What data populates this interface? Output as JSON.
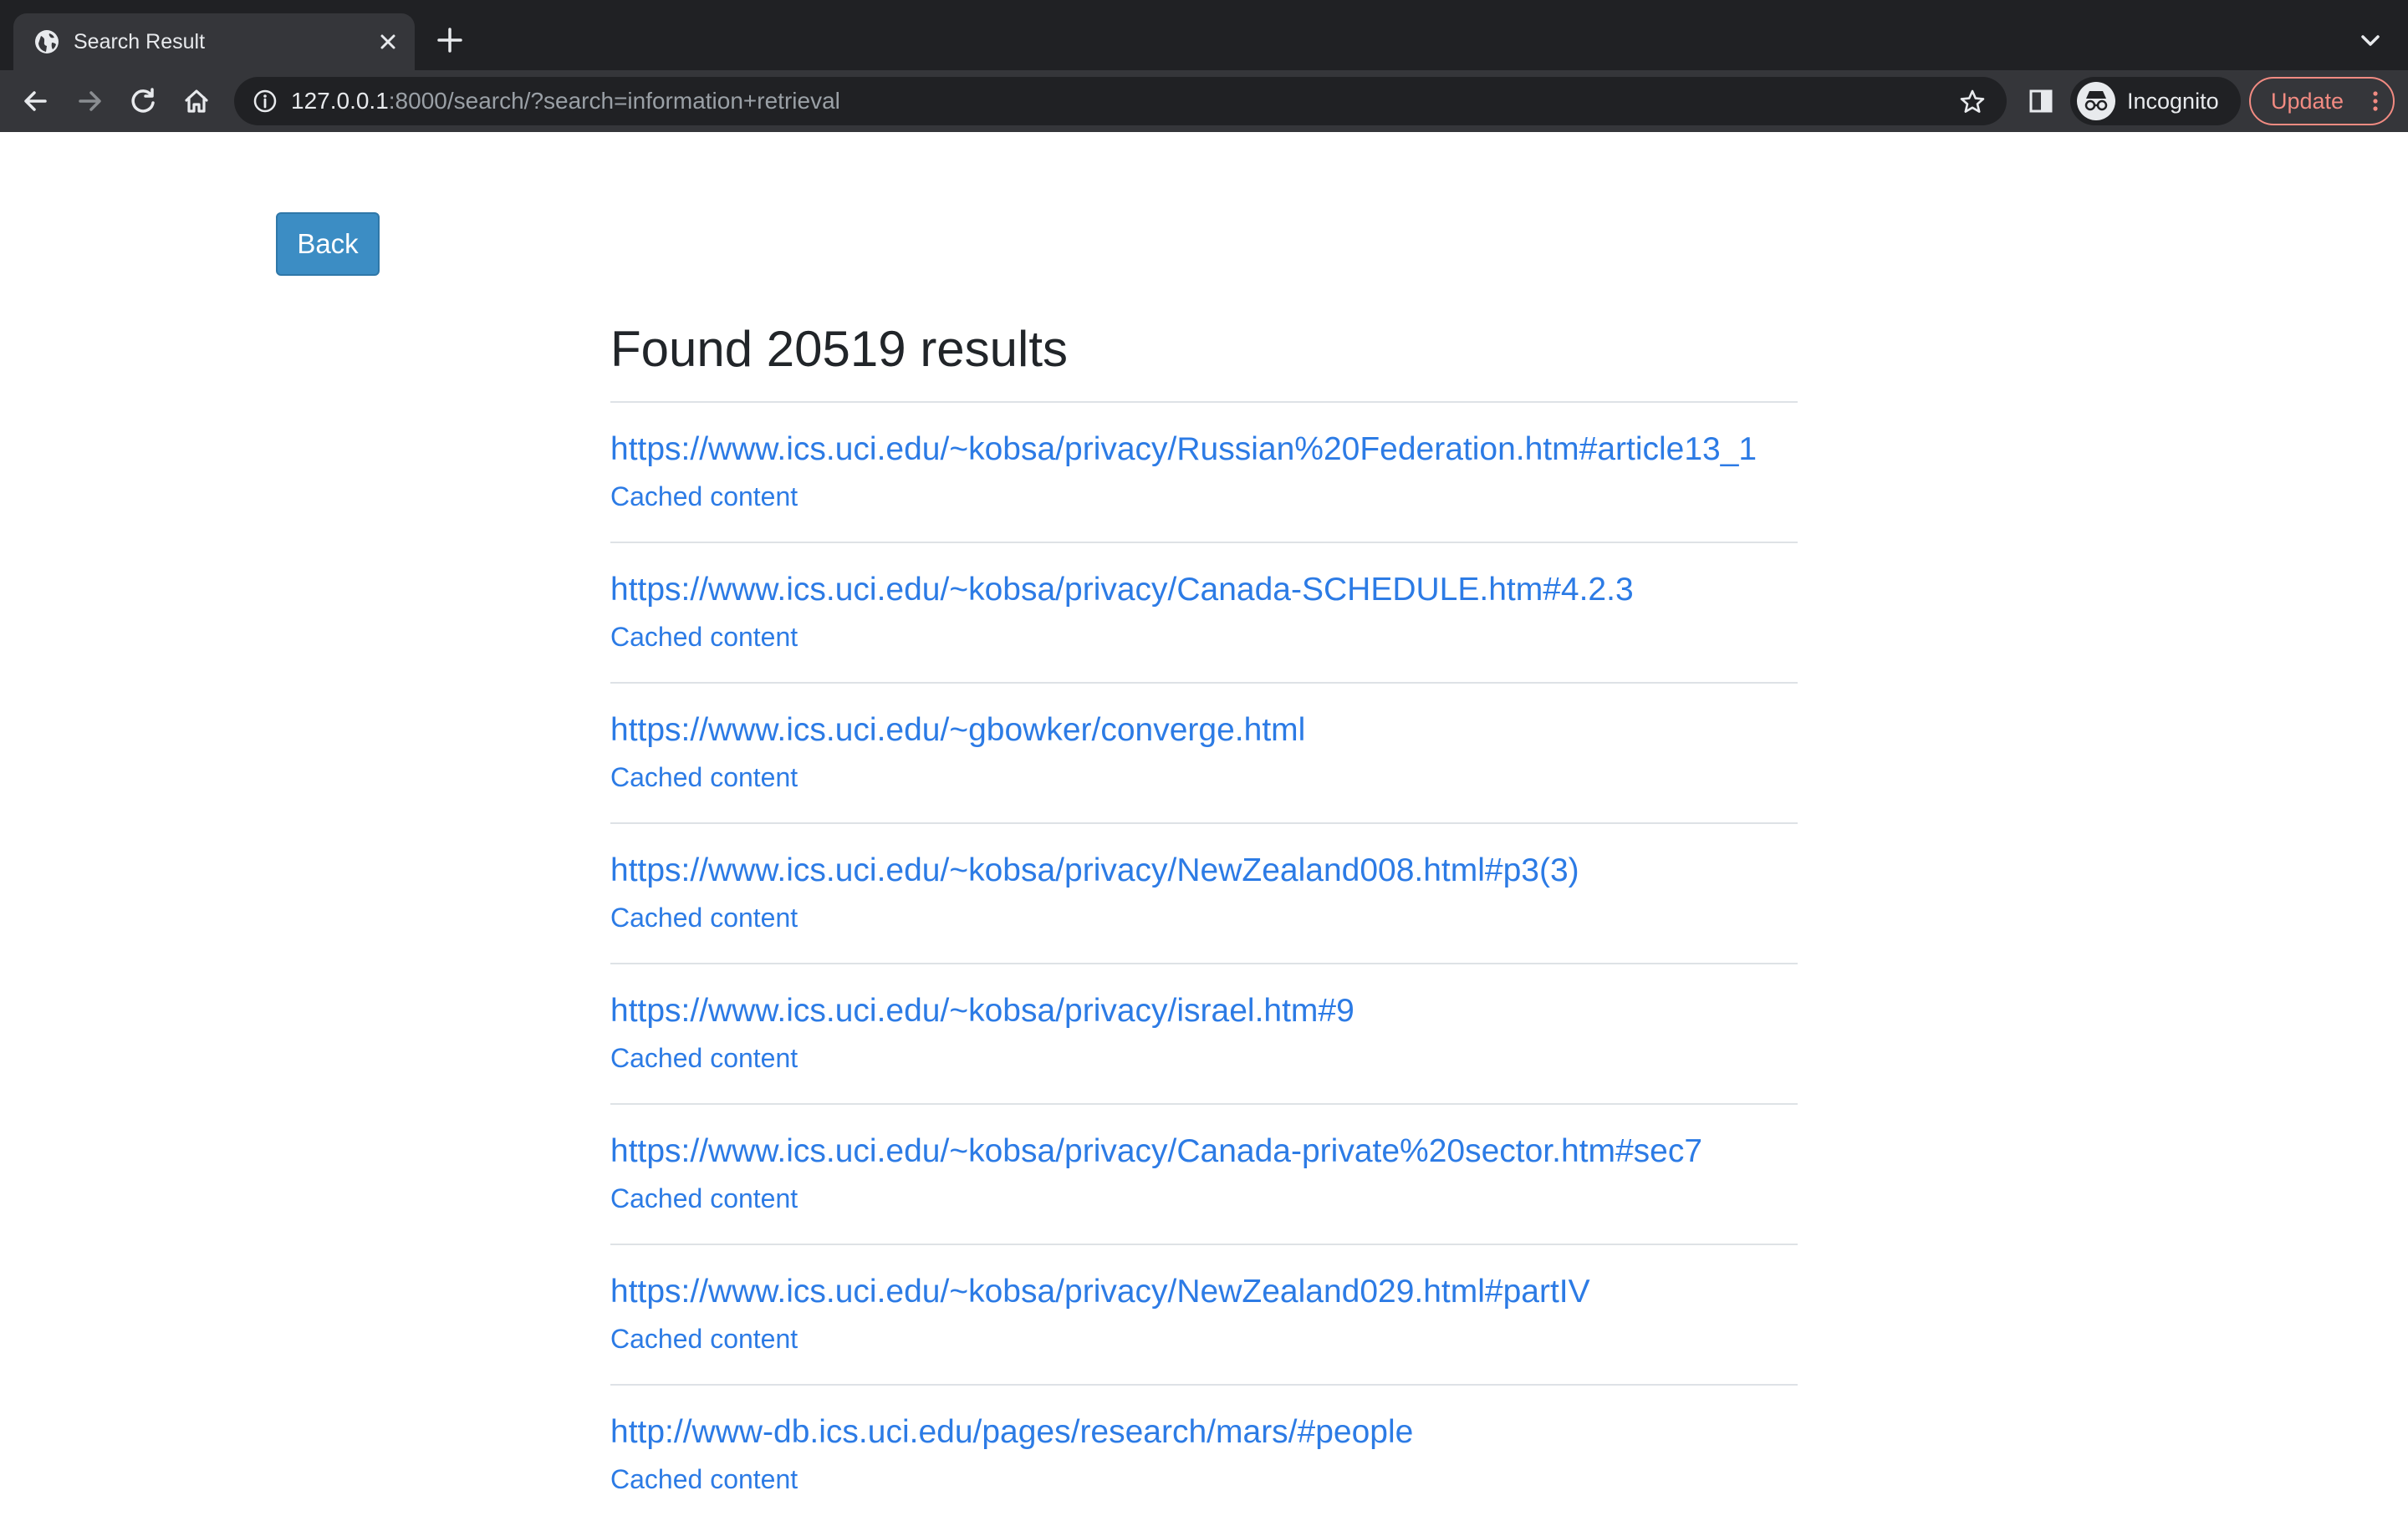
{
  "browser": {
    "tab_title": "Search Result",
    "url_host": "127.0.0.1",
    "url_rest": ":8000/search/?search=information+retrieval",
    "profile_label": "Incognito",
    "update_label": "Update"
  },
  "page": {
    "back_label": "Back",
    "heading": "Found 20519 results",
    "results": [
      {
        "url": "https://www.ics.uci.edu/~kobsa/privacy/Russian%20Federation.htm#article13_1",
        "cached_label": "Cached content"
      },
      {
        "url": "https://www.ics.uci.edu/~kobsa/privacy/Canada-SCHEDULE.htm#4.2.3",
        "cached_label": "Cached content"
      },
      {
        "url": "https://www.ics.uci.edu/~gbowker/converge.html",
        "cached_label": "Cached content"
      },
      {
        "url": "https://www.ics.uci.edu/~kobsa/privacy/NewZealand008.html#p3(3)",
        "cached_label": "Cached content"
      },
      {
        "url": "https://www.ics.uci.edu/~kobsa/privacy/israel.htm#9",
        "cached_label": "Cached content"
      },
      {
        "url": "https://www.ics.uci.edu/~kobsa/privacy/Canada-private%20sector.htm#sec7",
        "cached_label": "Cached content"
      },
      {
        "url": "https://www.ics.uci.edu/~kobsa/privacy/NewZealand029.html#partIV",
        "cached_label": "Cached content"
      },
      {
        "url": "http://www-db.ics.uci.edu/pages/research/mars/#people",
        "cached_label": "Cached content"
      }
    ]
  },
  "colors": {
    "link": "#2c7be5",
    "back_button": "#3c8dc4",
    "heading": "#212529"
  }
}
